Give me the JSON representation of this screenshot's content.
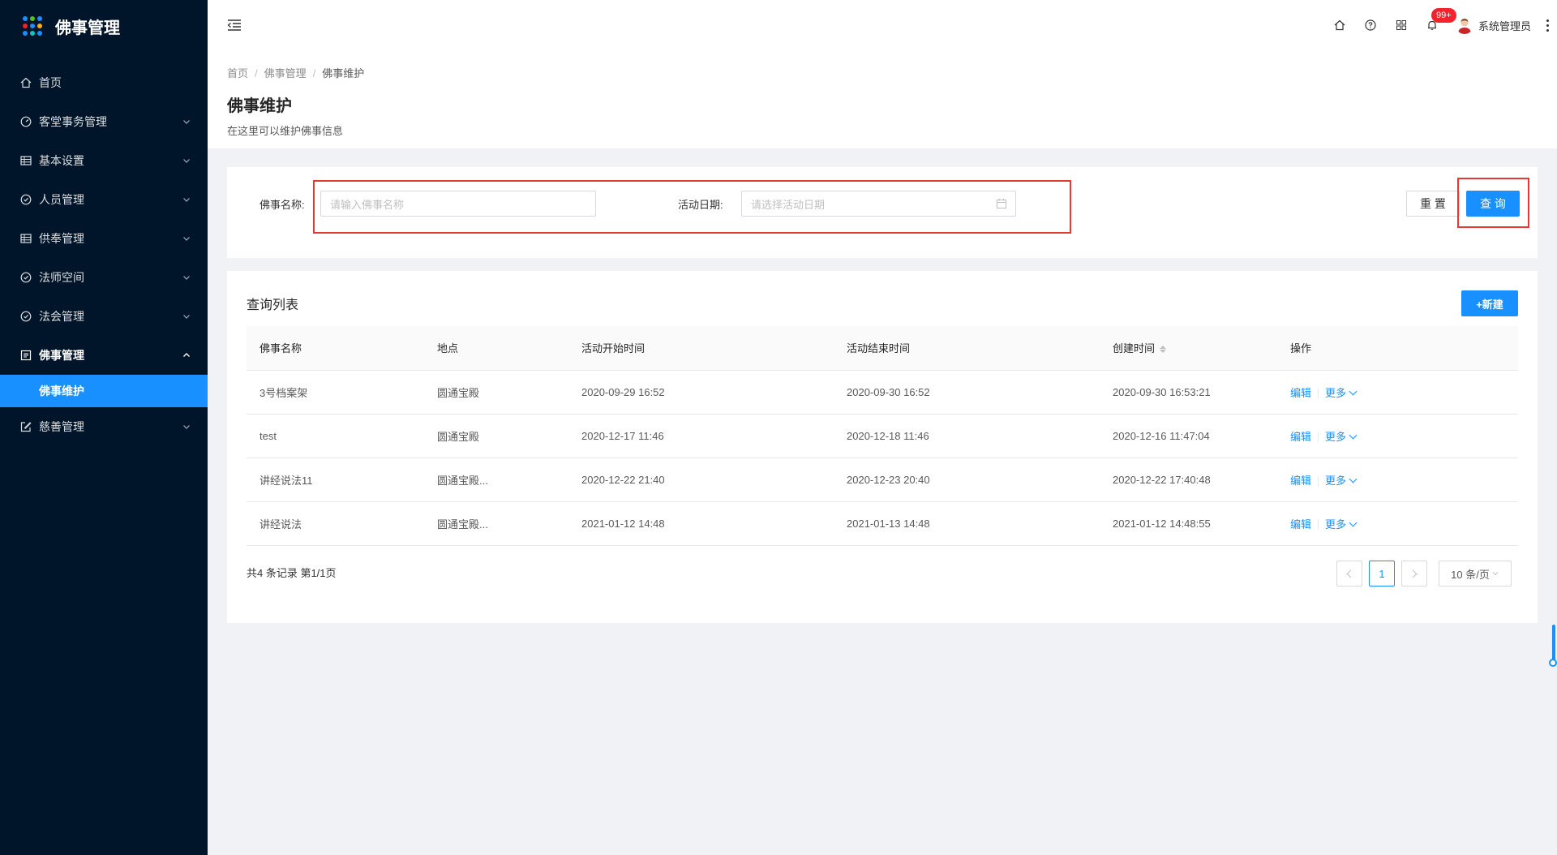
{
  "app": {
    "title": "佛事管理"
  },
  "colors": {
    "sidebar_bg": "#001529",
    "primary": "#1890ff",
    "highlight": "#e53935",
    "badge": "#f5222d"
  },
  "sidebar": {
    "items": [
      {
        "label": "首页",
        "icon": "home-icon"
      },
      {
        "label": "客堂事务管理",
        "icon": "dashboard-icon"
      },
      {
        "label": "基本设置",
        "icon": "table-icon"
      },
      {
        "label": "人员管理",
        "icon": "check-circle-icon"
      },
      {
        "label": "供奉管理",
        "icon": "table-icon"
      },
      {
        "label": "法师空间",
        "icon": "check-circle-icon"
      },
      {
        "label": "法会管理",
        "icon": "check-circle-icon"
      },
      {
        "label": "佛事管理",
        "icon": "profile-icon",
        "sub": "佛事维护"
      },
      {
        "label": "慈善管理",
        "icon": "edit-icon"
      }
    ]
  },
  "header": {
    "badge": "99+",
    "user_name": "系统管理员",
    "icons": [
      "home-icon",
      "question-icon",
      "apps-icon",
      "bell-icon"
    ]
  },
  "page": {
    "breadcrumb": [
      "首页",
      "佛事管理",
      "佛事维护"
    ],
    "title": "佛事维护",
    "desc": "在这里可以维护佛事信息"
  },
  "search": {
    "name_label": "佛事名称:",
    "name_placeholder": "请输入佛事名称",
    "date_label": "活动日期:",
    "date_placeholder": "请选择活动日期",
    "reset_label": "重 置",
    "query_label": "查 询"
  },
  "table": {
    "title": "查询列表",
    "new_label": "+新建",
    "columns": [
      "佛事名称",
      "地点",
      "活动开始时间",
      "活动结束时间",
      "创建时间",
      "操作"
    ],
    "rows": [
      {
        "name": "3号档案架",
        "place": "圆通宝殿",
        "start": "2020-09-29 16:52",
        "end": "2020-09-30 16:52",
        "created": "2020-09-30 16:53:21"
      },
      {
        "name": "test",
        "place": "圆通宝殿",
        "start": "2020-12-17 11:46",
        "end": "2020-12-18 11:46",
        "created": "2020-12-16 11:47:04"
      },
      {
        "name": "讲经说法11",
        "place": "圆通宝殿...",
        "start": "2020-12-22 21:40",
        "end": "2020-12-23 20:40",
        "created": "2020-12-22 17:40:48"
      },
      {
        "name": "讲经说法",
        "place": "圆通宝殿...",
        "start": "2021-01-12 14:48",
        "end": "2021-01-13 14:48",
        "created": "2021-01-12 14:48:55"
      }
    ],
    "edit_label": "编辑",
    "more_label": "更多"
  },
  "pagination": {
    "total_text": "共4 条记录 第1/1页",
    "current": "1",
    "page_size": "10 条/页"
  }
}
